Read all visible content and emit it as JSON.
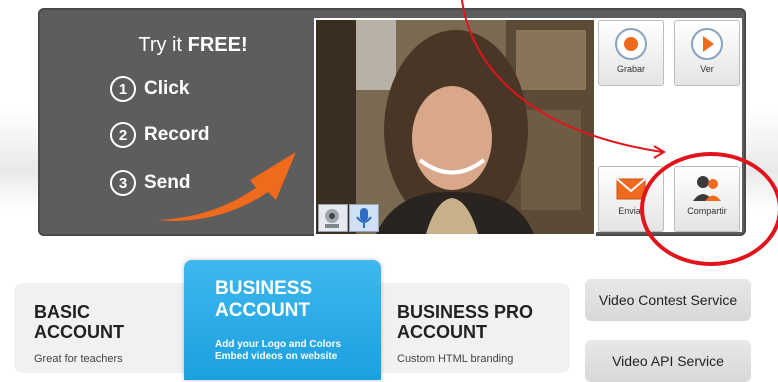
{
  "widget": {
    "try_title": "Try it",
    "try_free": "FREE!",
    "steps": [
      {
        "num": "1",
        "label": "Click"
      },
      {
        "num": "2",
        "label": "Record"
      },
      {
        "num": "3",
        "label": "Send"
      }
    ]
  },
  "controls": {
    "record_label": "Grabar",
    "view_label": "Ver",
    "send_label": "Enviar",
    "share_label": "Compartir"
  },
  "plans": {
    "basic": {
      "title": "BASIC ACCOUNT",
      "desc": "Great for teachers"
    },
    "business": {
      "title": "BUSINESS ACCOUNT",
      "desc_line1": "Add your Logo and Colors",
      "desc_line2": "Embed videos on website"
    },
    "pro": {
      "title": "BUSINESS PRO ACCOUNT",
      "desc": "Custom HTML branding"
    }
  },
  "side_buttons": {
    "contest": "Video Contest Service",
    "api": "Video API Service"
  },
  "colors": {
    "accent_orange": "#f06a1e",
    "business_blue": "#1ba0e0",
    "highlight_red": "#e2141b"
  }
}
